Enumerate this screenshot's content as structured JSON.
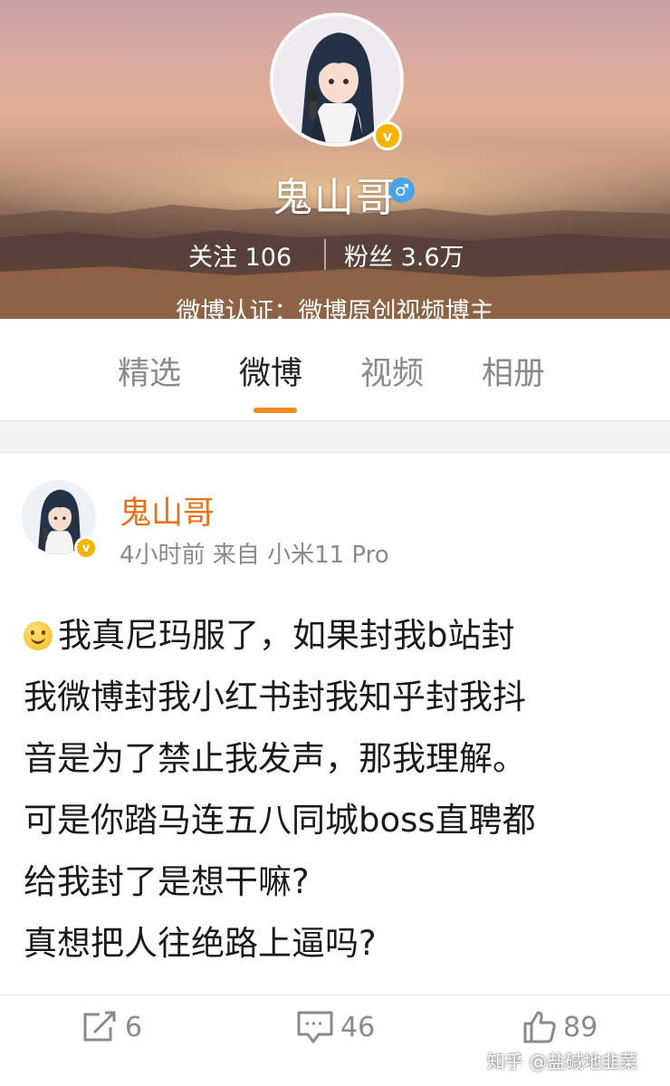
{
  "profile": {
    "name": "鬼山哥",
    "gender_symbol": "♂",
    "verified_badge": "v",
    "following_label": "关注",
    "following_count": "106",
    "followers_label": "粉丝",
    "followers_count": "3.6万",
    "verification": "微博认证：微博原创视频博主"
  },
  "tabs": [
    {
      "label": "精选",
      "active": false
    },
    {
      "label": "微博",
      "active": true
    },
    {
      "label": "视频",
      "active": false
    },
    {
      "label": "相册",
      "active": false
    }
  ],
  "post": {
    "author": "鬼山哥",
    "verified_badge": "v",
    "meta": "4小时前 来自 小米11 Pro",
    "emoji": "smile-emoji",
    "lines": [
      "我真尼玛服了，如果封我b站封",
      "我微博封我小红书封我知乎封我抖",
      "音是为了禁止我发声，那我理解。",
      "可是你踏马连五八同城boss直聘都",
      "给我封了是想干嘛?",
      "真想把人往绝路上逼吗?"
    ],
    "repost_count": "6",
    "comment_count": "46",
    "like_count": "89"
  },
  "watermark": "知乎 @盐碱地韭菜",
  "colors": {
    "accent_orange": "#f28a22",
    "author_orange": "#e8701a",
    "verified_gold": "#f6b400",
    "gender_blue": "#4aa3e6"
  }
}
